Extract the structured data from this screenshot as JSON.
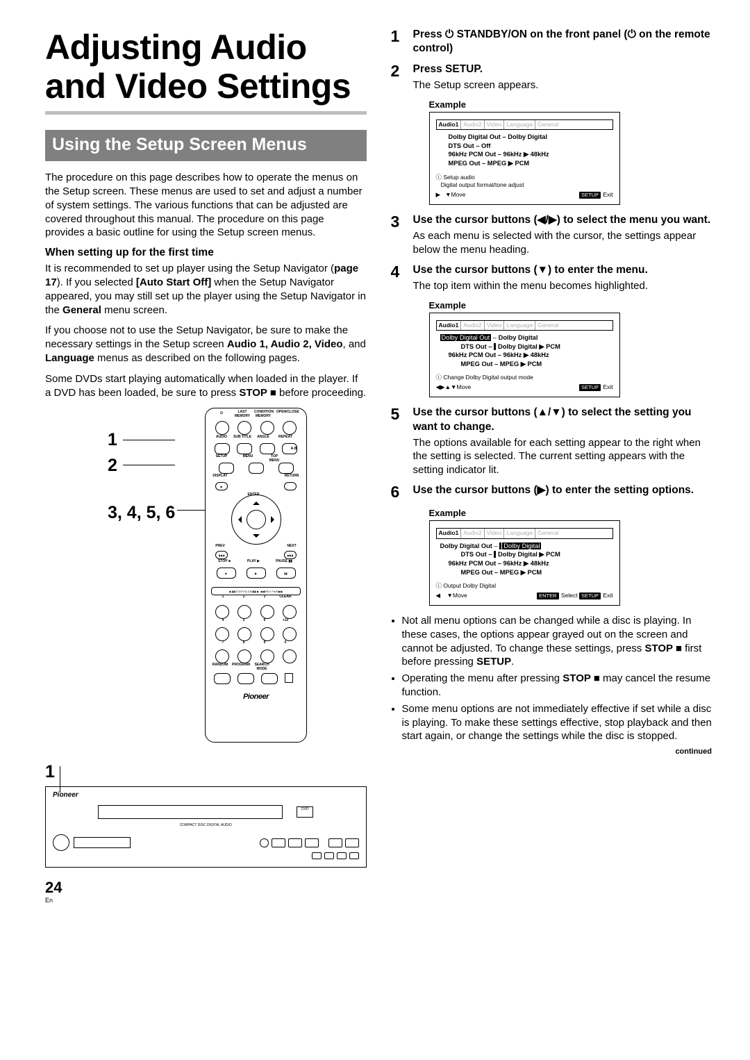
{
  "title": "Adjusting Audio and Video Settings",
  "section_heading": "Using the Setup Screen Menus",
  "intro": "The procedure on this page describes how to operate the menus on the Setup screen. These menus are used to set and adjust a number of system settings. The various functions that can be adjusted are covered throughout this manual. The procedure on this page provides a basic outline for using the Setup screen menus.",
  "first_time_heading": "When setting up for the first time",
  "first_time_p1a": "It is recommended to set up player using the Setup Navigator (",
  "first_time_page_ref": "page 17",
  "first_time_p1b": "). If you selected ",
  "first_time_bold_auto": "[Auto Start Off]",
  "first_time_p1c": " when the Setup Navigator appeared, you may still set up the player using the Setup Navigator in the ",
  "first_time_bold_general": "General",
  "first_time_p1d": " menu screen.",
  "first_time_p2a": "If you choose not to use the Setup Navigator, be sure to make the necessary settings in the Setup screen ",
  "first_time_bold_menus": "Audio 1, Audio 2, Video",
  "first_time_p2b": ", and ",
  "first_time_bold_lang": "Language",
  "first_time_p2c": " menus as described on the following pages.",
  "first_time_p3a": "Some DVDs start playing automatically when loaded in the player. If a DVD has been loaded, be sure to press ",
  "first_time_bold_stop": "STOP ■",
  "first_time_p3b": "  before proceeding.",
  "remote_labels": {
    "r1": "1",
    "r2": "2",
    "r3": "3, 4, 5, 6"
  },
  "player_label": "1",
  "rc_brand": "Pioneer",
  "rc_btn_labels": {
    "last_memory": "LAST MEMORY",
    "condition_memory": "CONDITION MEMORY",
    "open_close": "OPEN/CLOSE",
    "audio": "AUDIO",
    "subtitle": "SUB TITLE",
    "angle": "ANGLE",
    "repeat": "REPEAT",
    "ab": "A-B",
    "setup": "SETUP",
    "menu": "MENU",
    "top_menu": "TOP MENU",
    "display": "DISPLAY",
    "return": "RETURN",
    "enter": "ENTER",
    "prev": "PREV",
    "next": "NEXT",
    "stop": "STOP ■",
    "play": "PLAY ▶",
    "pause": "PAUSE ▮▮",
    "step_slow": "◀ ▮▮STEP/SLOW▮▮ ▶   ◀◀REV    FWD▶▶",
    "clear": "CLEAR",
    "plus10": "+10",
    "random": "RANDOM",
    "program": "PROGRAM",
    "search": "SEARCH MODE"
  },
  "steps": {
    "s1": {
      "num": "1",
      "head_a": "Press ",
      "head_b": " STANDBY/ON on the front panel (",
      "head_c": " on the remote control)"
    },
    "s2": {
      "num": "2",
      "head": "Press SETUP.",
      "desc": "The Setup screen appears."
    },
    "s3": {
      "num": "3",
      "head": "Use the cursor buttons (◀/▶) to select the menu you want.",
      "desc": "As each menu is selected with the cursor, the settings appear below the menu heading."
    },
    "s4": {
      "num": "4",
      "head": "Use the cursor buttons (▼) to enter the menu.",
      "desc": "The top item within the menu becomes highlighted."
    },
    "s5": {
      "num": "5",
      "head": "Use the cursor buttons (▲/▼) to select the setting you want to change.",
      "desc": "The options available for each setting appear to the right when the setting is selected. The current setting appears with the setting indicator lit."
    },
    "s6": {
      "num": "6",
      "head": "Use the cursor buttons (▶)  to enter the setting options."
    }
  },
  "example_label": "Example",
  "osd": {
    "tabs": [
      "Audio1",
      "Audio2",
      "Video",
      "Language",
      "General"
    ],
    "lines": {
      "dd": "Dolby Digital Out – Dolby Digital",
      "dts": "DTS Out – Off",
      "k96": "96kHz PCM Out – 96kHz ▶ 48kHz",
      "mpeg": "MPEG Out – MPEG ▶ PCM",
      "dd_label": "Dolby Digital Out",
      "dd_val": "Dolby Digital",
      "dts_label": "DTS Out –",
      "dts_val": "Dolby Digital ▶ PCM"
    },
    "hint1a": "Setup audio",
    "hint1b": "Digital output format/tone adjust",
    "hint2": "Change Dolby Digital output mode",
    "hint3": "Output Dolby Digital",
    "move": "Move",
    "select": "Select",
    "exit": "Exit",
    "chip_setup": "SETUP",
    "chip_enter": "ENTER",
    "info_icon": "ⓘ"
  },
  "notes": {
    "n1a": "Not all menu options can be changed while a disc is playing. In these cases, the options appear grayed out on the screen and cannot be adjusted. To change these settings, press ",
    "n1b": "STOP ■",
    "n1c": " first before pressing ",
    "n1d": "SETUP",
    "n1e": ".",
    "n2a": "Operating the menu after pressing ",
    "n2b": "STOP ■",
    "n2c": " may cancel the resume function.",
    "n3": "Some menu options are not immediately effective if set while a disc is playing. To make these settings effective, stop playback and then start again, or change the settings while the disc is stopped."
  },
  "continued": "continued",
  "player_text": {
    "model": "",
    "dvd": "DVD",
    "compact": "COMPACT DISC DIGITAL AUDIO"
  },
  "page_number": "24",
  "page_lang": "En"
}
